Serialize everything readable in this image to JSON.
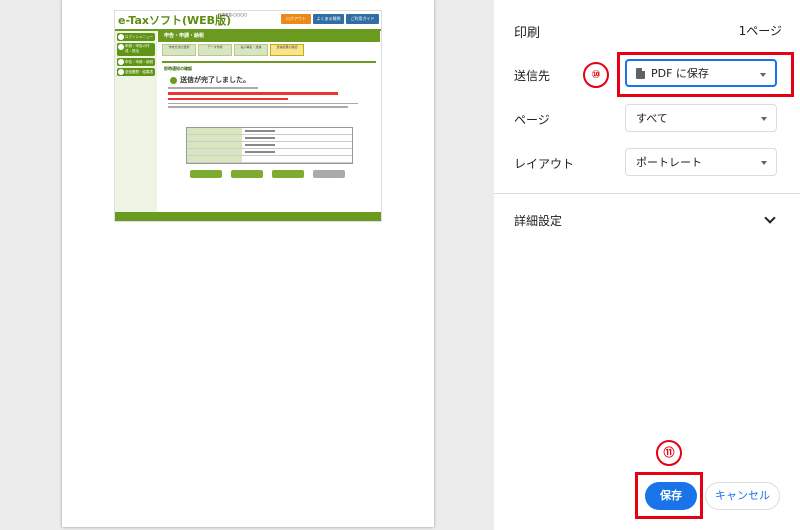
{
  "preview": {
    "thumb": {
      "logo": "e-Taxソフト(WEB版)",
      "header_info": "作成者名:〇〇〇〇",
      "logout": "ログアウト",
      "faq": "よくある質問",
      "guide": "ご利用ガイド",
      "side_items": [
        "ログインメニュー",
        "申請・申告の作成・提出",
        "申告・申請・納税",
        "送信履歴・結果表示"
      ],
      "title": "申告・申請・納税",
      "steps": [
        "作成方法の選択",
        "データ作成",
        "電子署名・送信",
        "送信結果の確認"
      ],
      "section": "即時通知の確認",
      "done": "送信が完了しました。",
      "action_buttons": [
        "印刷",
        "保存",
        "受付結果の確認",
        "メインメニュー"
      ]
    }
  },
  "panel": {
    "title": "印刷",
    "page_count": "1ページ",
    "destination_label": "送信先",
    "destination_value": "PDF に保存",
    "pages_label": "ページ",
    "pages_value": "すべて",
    "layout_label": "レイアウト",
    "layout_value": "ポートレート",
    "advanced_label": "詳細設定",
    "save_label": "保存",
    "cancel_label": "キャンセル"
  },
  "annotations": {
    "step10": "⑩",
    "step11": "⑪",
    "color": "#e60012"
  },
  "colors": {
    "accent": "#1a73e8",
    "etax_green": "#6a9a1f"
  }
}
